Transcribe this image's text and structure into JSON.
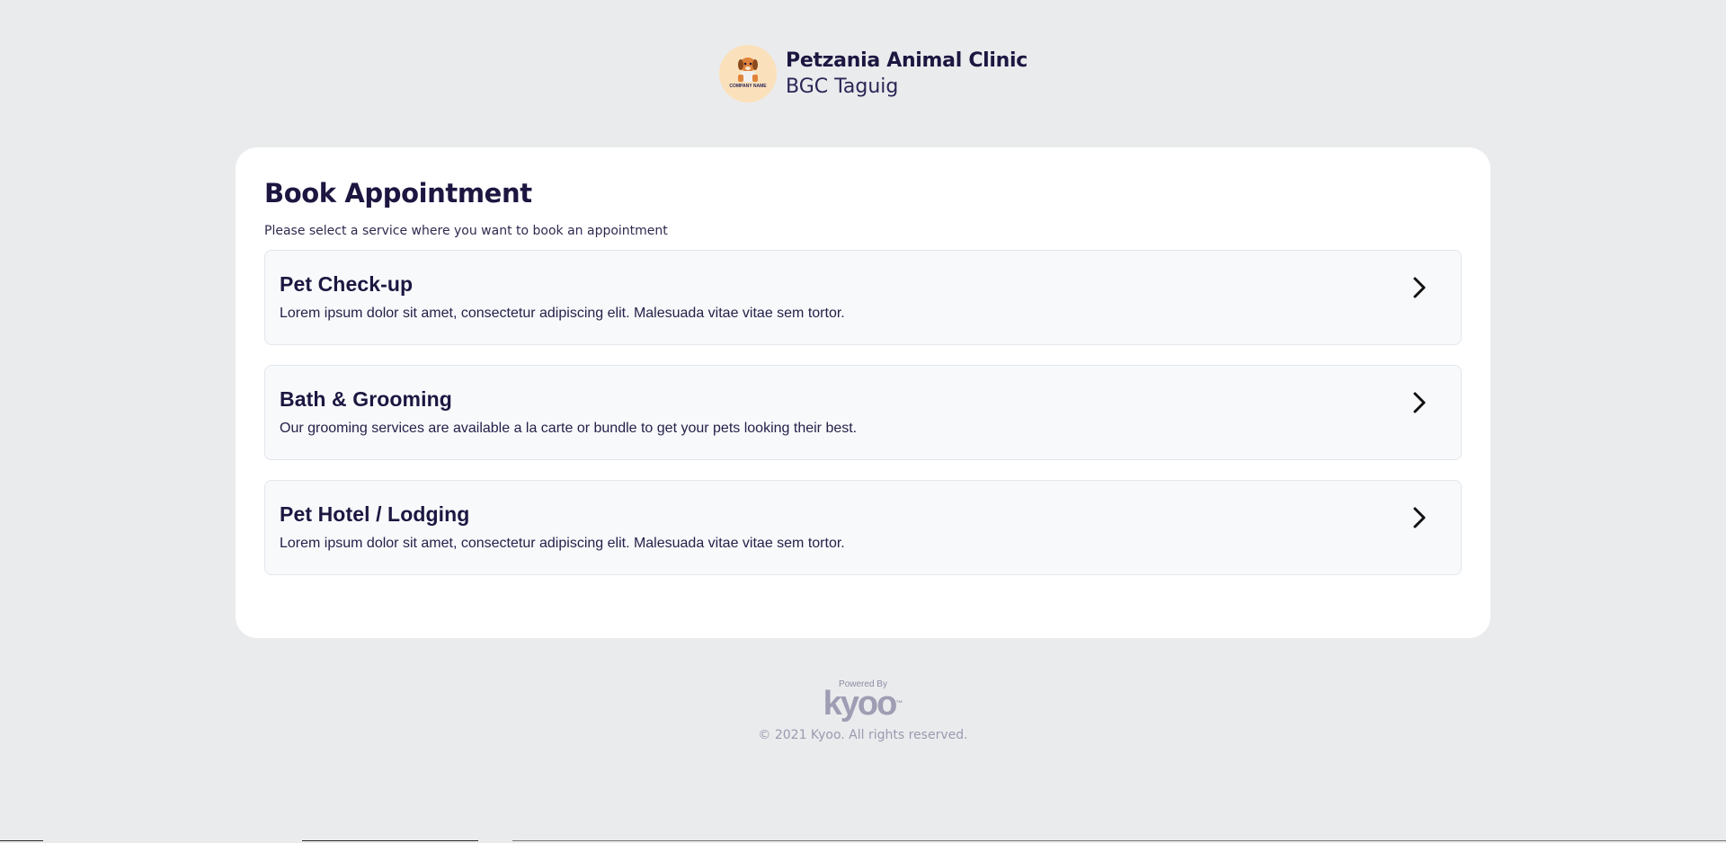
{
  "clinic": {
    "name": "Petzania Animal Clinic",
    "branch": "BGC Taguig",
    "logo_text": "COMPANY NAME",
    "logo_icon": "dog-logo-icon"
  },
  "main": {
    "title": "Book Appointment",
    "subtitle": "Please select a service where you want to book an appointment",
    "services": [
      {
        "title": "Pet Check-up",
        "description": "Lorem ipsum dolor sit amet, consectetur adipiscing elit. Malesuada vitae vitae sem tortor.",
        "icon": "chevron-right-icon"
      },
      {
        "title": "Bath & Grooming",
        "description": "Our grooming services are available a la carte or bundle to get your pets looking their best.",
        "icon": "chevron-right-icon"
      },
      {
        "title": "Pet Hotel / Lodging",
        "description": "Lorem ipsum dolor sit amet, consectetur adipiscing elit. Malesuada vitae vitae sem tortor.",
        "icon": "chevron-right-icon"
      }
    ]
  },
  "footer": {
    "powered_by": "Powered By",
    "brand": "kyoo",
    "trademark": "™",
    "copyright": "© 2021 Kyoo. All rights reserved."
  },
  "colors": {
    "background": "#eaebed",
    "text_primary": "#1c1641",
    "card_background": "#ffffff",
    "service_background": "#f8f9fb",
    "logo_background": "#fbe1bb"
  }
}
